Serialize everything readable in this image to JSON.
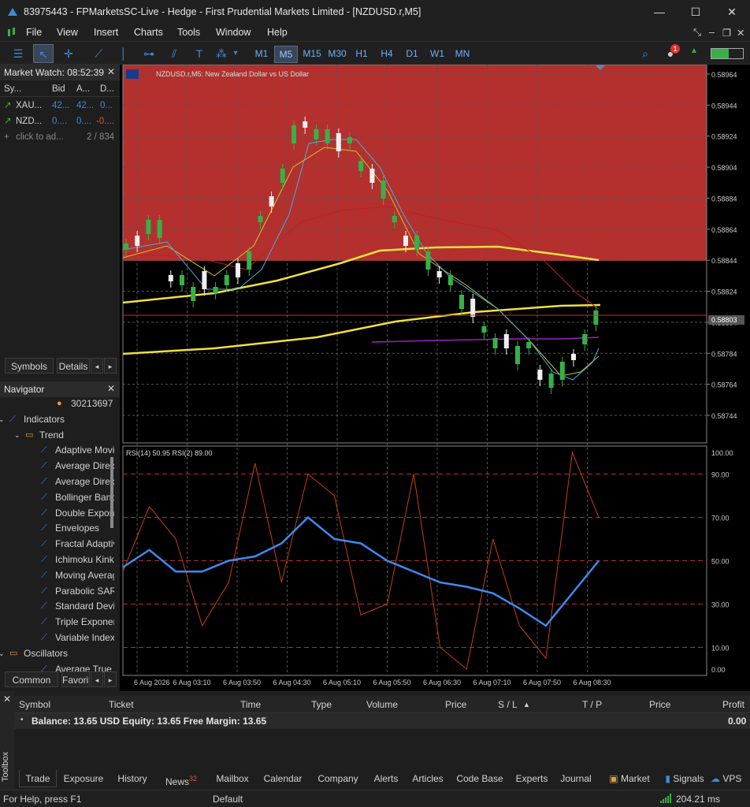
{
  "window": {
    "title": "83975443 - FPMarketsSC-Live - Hedge - First Prudential Markets Limited - [NZDUSD.r,M5]",
    "minimize": "—",
    "maximize": "☐",
    "close": "✕"
  },
  "menu": [
    "File",
    "View",
    "Insert",
    "Charts",
    "Tools",
    "Window",
    "Help"
  ],
  "timeframes": [
    "M1",
    "M5",
    "M15",
    "M30",
    "H1",
    "H4",
    "D1",
    "W1",
    "MN"
  ],
  "selected_timeframe": "M5",
  "market_watch": {
    "title": "Market Watch: 08:52:39",
    "headers": [
      "Sy...",
      "Bid",
      "A...",
      "D..."
    ],
    "rows": [
      {
        "symbol": "XAU...",
        "bid": "42...",
        "ask": "42...",
        "daily": "0...",
        "color": "#3d8bd9"
      },
      {
        "symbol": "NZD...",
        "bid": "0....",
        "ask": "0....",
        "daily": "-0....",
        "color": "#e05050"
      }
    ],
    "add": "click to ad...",
    "count": "2 / 834",
    "tabs": [
      "Symbols",
      "Details"
    ]
  },
  "navigator": {
    "title": "Navigator",
    "items": [
      {
        "label": "30213697",
        "indent": 90,
        "icon": "account-icon"
      },
      {
        "label": "Indicators",
        "indent": 30,
        "icon": "folder-indicators-icon"
      },
      {
        "label": "Trend",
        "indent": 50,
        "icon": "folder-icon"
      },
      {
        "label": "Adaptive Moving Average",
        "indent": 70,
        "icon": "indicator-icon"
      },
      {
        "label": "Average Directional Movement Index",
        "indent": 70,
        "icon": "indicator-icon"
      },
      {
        "label": "Average Directional Movement Index Wilder",
        "indent": 70,
        "icon": "indicator-icon"
      },
      {
        "label": "Bollinger Bands",
        "indent": 70,
        "icon": "indicator-icon"
      },
      {
        "label": "Double Exponential Moving Average",
        "indent": 70,
        "icon": "indicator-icon"
      },
      {
        "label": "Envelopes",
        "indent": 70,
        "icon": "indicator-icon"
      },
      {
        "label": "Fractal Adaptive Moving Average",
        "indent": 70,
        "icon": "indicator-icon"
      },
      {
        "label": "Ichimoku Kinko Hyo",
        "indent": 70,
        "icon": "indicator-icon"
      },
      {
        "label": "Moving Average",
        "indent": 70,
        "icon": "indicator-icon"
      },
      {
        "label": "Parabolic SAR",
        "indent": 70,
        "icon": "indicator-icon"
      },
      {
        "label": "Standard Deviation",
        "indent": 70,
        "icon": "indicator-icon"
      },
      {
        "label": "Triple Exponential Moving Average",
        "indent": 70,
        "icon": "indicator-icon"
      },
      {
        "label": "Variable Index Dynamic Average",
        "indent": 70,
        "icon": "indicator-icon"
      },
      {
        "label": "Oscillators",
        "indent": 30,
        "icon": "folder-icon"
      },
      {
        "label": "Average True Range",
        "indent": 70,
        "icon": "indicator-icon"
      }
    ],
    "tabs": [
      "Common",
      "Favorites"
    ]
  },
  "chart": {
    "title": "NZDUSD.r,M5:  New Zealand Dollar vs US Dollar",
    "price_labels": [
      "0.58964",
      "0.58944",
      "0.58924",
      "0.58904",
      "0.58884",
      "0.58864",
      "0.58844",
      "0.58824",
      "0.58804",
      "0.58784",
      "0.58764",
      "0.58744"
    ],
    "current_price": "0.58803",
    "rsi_title": "RSI(14) 50.95 RSI(2) 89.00",
    "rsi_labels": [
      "100.00",
      "90.00",
      "70.00",
      "50.00",
      "30.00",
      "10.00",
      "0.00"
    ],
    "time_labels": [
      "6 Aug 2026",
      "6 Aug 03:10",
      "6 Aug 03:50",
      "6 Aug 04:30",
      "6 Aug 05:10",
      "6 Aug 05:50",
      "6 Aug 06:30",
      "6 Aug 07:10",
      "6 Aug 07:50",
      "6 Aug 08:30"
    ]
  },
  "chart_data": {
    "type": "line",
    "price_axis": [
      0.58964,
      0.58744
    ],
    "x": [
      "6 Aug 2026",
      "6 Aug 03:10",
      "6 Aug 03:50",
      "6 Aug 04:30",
      "6 Aug 05:10",
      "6 Aug 05:50",
      "6 Aug 06:30",
      "6 Aug 07:10",
      "6 Aug 07:50",
      "6 Aug 08:30"
    ],
    "series": [
      {
        "name": "",
        "values": [
          0.58855,
          0.5886,
          0.5882,
          0.5883,
          0.58885,
          0.58935,
          0.589,
          0.5885,
          0.5884,
          0.5882,
          0.58775,
          0.58795
        ],
        "color": "#38b048"
      }
    ],
    "rsi14": [
      47,
      55,
      45,
      45,
      50,
      52,
      58,
      70,
      60,
      58,
      50,
      45,
      40,
      38,
      35,
      28,
      20,
      35,
      50
    ],
    "rsi2": [
      45,
      75,
      60,
      20,
      40,
      95,
      40,
      90,
      80,
      25,
      30,
      90,
      10,
      0,
      60,
      20,
      5,
      100,
      70
    ]
  },
  "toolbox": {
    "headers": [
      "Symbol",
      "Ticket",
      "Time",
      "Type",
      "Volume",
      "Price",
      "S / L",
      "T / P",
      "Price",
      "Profit"
    ],
    "balance": "Balance: 13.65 USD  Equity: 13.65  Free Margin: 13.65",
    "profit": "0.00",
    "label": "Toolbox",
    "tabs": [
      "Trade",
      "Exposure",
      "History",
      "News",
      "Mailbox",
      "Calendar",
      "Company",
      "Alerts",
      "Articles",
      "Code Base",
      "Experts",
      "Journal"
    ],
    "news_count": "32",
    "right_tabs": [
      "Market",
      "Signals",
      "VPS"
    ]
  },
  "status": {
    "help": "For Help, press F1",
    "profile": "Default",
    "ping": "204.21 ms"
  }
}
